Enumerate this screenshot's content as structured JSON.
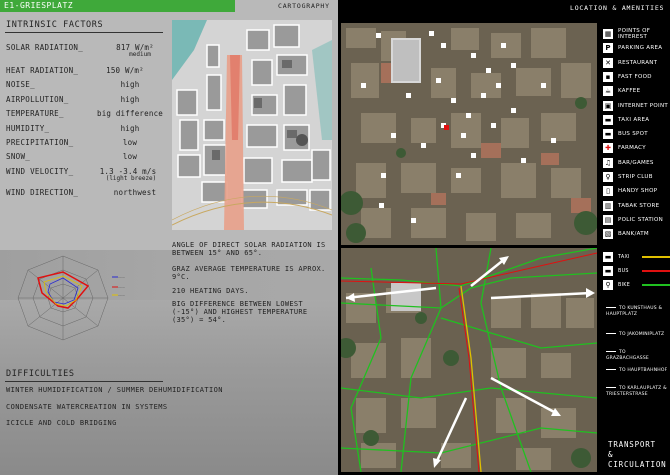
{
  "header": {
    "title": "E1-GRIESPLATZ",
    "section": "CARTOGRAPHY"
  },
  "intrinsic": {
    "title": "INTRINSIC FACTORS",
    "factors": [
      {
        "label": "SOLAR RADIATION_",
        "value": "817 W/m²",
        "sub": "medium"
      },
      {
        "label": "HEAT RADIATION_",
        "value": "150 W/m²",
        "sub": ""
      },
      {
        "label": "NOISE_",
        "value": "high",
        "sub": ""
      },
      {
        "label": "AIRPOLLUTION_",
        "value": "high",
        "sub": ""
      },
      {
        "label": "TEMPERATURE_",
        "value": "big difference",
        "sub": ""
      },
      {
        "label": "HUMIDITY_",
        "value": "high",
        "sub": ""
      },
      {
        "label": "PRECIPITATION_",
        "value": "low",
        "sub": ""
      },
      {
        "label": "SNOW_",
        "value": "low",
        "sub": ""
      },
      {
        "label": "WIND VELOCITY_",
        "value": "1.3 -3.4 m/s",
        "sub": "(light breeze)"
      },
      {
        "label": "WIND DIRECTION_",
        "value": "northwest",
        "sub": ""
      }
    ]
  },
  "notes": [
    "ANGLE OF DIRECT SOLAR RADIATION IS BETWEEN 15° AND 65°.",
    "GRAZ AVERAGE TEMPERATURE IS APROX. 9°C.",
    "210 HEATING DAYS.",
    "BIG DIFFERENCE BETWEEN LOWEST (-15°) AND HIGHEST TEMPERATURE (35°) = 54°."
  ],
  "difficulties": {
    "title": "DIFFICULTIES",
    "items": [
      "WINTER HUMIDIFICATION / SUMMER DEHUMIDIFICATION",
      "CONDENSATE WATERCREATION IN SYSTEMS",
      "ICICLE AND COLD BRIDGING"
    ]
  },
  "location": {
    "title": "LOCATION & AMENITIES",
    "legend": [
      {
        "icon": "▦",
        "label": "POINTS OF INTEREST"
      },
      {
        "icon": "P",
        "label": "PARKING AREA"
      },
      {
        "icon": "✕",
        "label": "RESTAURANT"
      },
      {
        "icon": "▪",
        "label": "FAST FOOD"
      },
      {
        "icon": "☕",
        "label": "KAFFEE"
      },
      {
        "icon": "▣",
        "label": "INTERNET POINT"
      },
      {
        "icon": "▬",
        "label": "TAXI AREA"
      },
      {
        "icon": "▬",
        "label": "BUS SPOT"
      },
      {
        "icon": "✚",
        "label": "FARMACY"
      },
      {
        "icon": "♫",
        "label": "BAR/GAMES"
      },
      {
        "icon": "♀",
        "label": "STRIP CLUB"
      },
      {
        "icon": "▯",
        "label": "HANDY SHOP"
      },
      {
        "icon": "▥",
        "label": "TABAK STORE"
      },
      {
        "icon": "▤",
        "label": "POLIC STATION"
      },
      {
        "icon": "▧",
        "label": "BANK/ATM"
      }
    ]
  },
  "transport": {
    "title": "TRANSPORT & CIRCULATION",
    "modes": [
      {
        "label": "TAXI",
        "color": "#e0c000"
      },
      {
        "label": "BUS",
        "color": "#e01010"
      },
      {
        "label": "BIKE",
        "color": "#20c020"
      }
    ],
    "destinations": [
      "TO KUNSTHAUS & HAUPTPLATZ",
      "TO JAKOMINIPLATZ",
      "TO GRAZBACHGASSE",
      "TO HAUPTBAHNHOF",
      "TO KARLAUPLATZ & TRIESTERSTRASE"
    ]
  },
  "radar": {
    "series": [
      {
        "color": "#e01010"
      },
      {
        "color": "#2a2ad0"
      },
      {
        "color": "#e0c000"
      }
    ]
  }
}
